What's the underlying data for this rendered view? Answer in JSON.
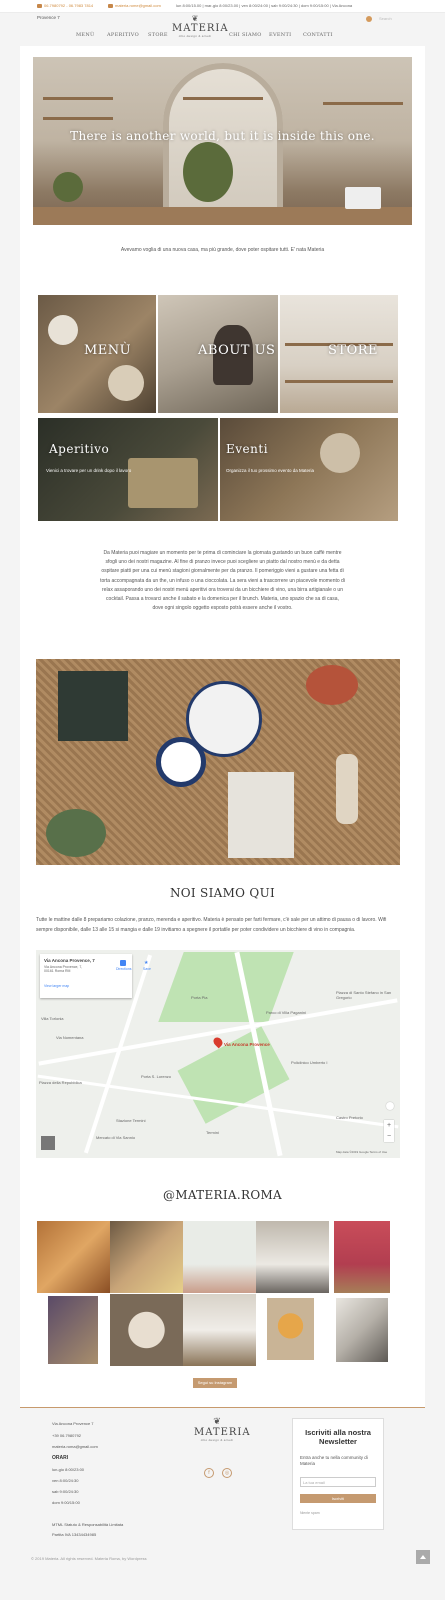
{
  "topbar": {
    "phone": "06.7980792 - 06.7983 7814",
    "email": "materia.rome@gmail.com",
    "hours": "lun 8:00/15.00 | mar-gio 8:00/23.00 | ven 8:00/24:00 | sab 9:00/24:30 | dom 9:00/15:00 | Via Ancona"
  },
  "header": {
    "location": "Provence 7",
    "search_placeholder": "Search",
    "logo_word": "MATERIA",
    "logo_sub": "cibo design & arredi",
    "nav": [
      "MENÙ",
      "APERITIVO",
      "STORE",
      "",
      "CHI SIAMO",
      "EVENTI",
      "CONTATTI"
    ]
  },
  "hero": {
    "title": "There is another world, but it is inside this one."
  },
  "intro": "Avevamo voglia di una nuova casa, ma più grande, dove poter ospitare tutti. E' nata Materia",
  "tiles": [
    {
      "label": "MENÙ"
    },
    {
      "label": "ABOUT US"
    },
    {
      "label": "STORE"
    },
    {
      "label": "Aperitivo",
      "desc": "Vienici a trovare per un drink dopo il lavoro"
    },
    {
      "label": "Eventi",
      "desc": "Organizza il tuo prossimo evento da Materia"
    }
  ],
  "about_paragraph": "Da Materia puoi magiare un momento per te prima di cominciare la giornata gustando un buon caffè mentre sfogli uno dei nostri magazine. Al fine di pranzo invece puoi scegliere un piatto dal nostro menù e da detta ospitare piatti per una cui menù stagioni giornalmente per da pranzo. Il pomeriggio vieni a gustare una fetta di torta accompagnata da un the, un infuso o una cioccolata. La sera vieni a trascorrere un piacevole momento di relax assaporando uno dei nostri menù aperitivi ora troverai da un bicchiere di vino, una birra artigianale o un cocktail. Passa a trovarci anche il sabato e la domenica per il brunch. Materia, uno spazio che sa di casa, dove ogni singolo oggetto esposto potrà essere anche il vostro.",
  "where": {
    "title": "NOI SIAMO QUI",
    "text": "Tutte le mattine dalle 8 prepariamo colazione, pranzo, merenda e aperitivo. Materia è pensato per farti fermare, c'è sale per un attimo di pausa o di lavoro. Wifi sempre disponibile, dalle 13 alle 15 si mangia e dalle 19 invitiamo a spegnere il portatile per poter condividere un bicchiere di vino in compagnia."
  },
  "map": {
    "place": "Via Ancona Provence, 7",
    "address": "Via Ancona Provence, 7, 00161 Roma RM",
    "directions": "Directions",
    "save": "Save",
    "larger": "View larger map",
    "pin_label": "Via Ancona Provence",
    "labels": [
      "Villa Torlonia",
      "Piazza di Santo Stefano in San Gregorio",
      "Policlinico Umberto I",
      "Porta S. Lorenzo",
      "Piazza della Repubblica",
      "Stazione Termini",
      "Porta Pia",
      "Termini",
      "Parco di Villa Paganini",
      "Via Nomentana",
      "Castro Pretorio",
      "Mercato di Via Sannio"
    ],
    "footer": "Map data ©2019 Google  Terms of Use"
  },
  "instagram": {
    "title": "@MATERIA.ROMA",
    "button": "Segui su Instagram"
  },
  "footer": {
    "address": "Via Ancona Provence 7",
    "phone": "+39 06.7980792",
    "email": "materia.roma@gmail.com",
    "hours_title": "ORARI",
    "hours": [
      "lun-gio 8:00/23:00",
      "ven 8:00/24:30",
      "sab 9:00/24:30",
      "dom 9:00/15:00"
    ],
    "policy": "MTML Statuto & Responsabilità Limitata",
    "vat": "Partita IVA 13434434985",
    "logo_word": "MATERIA",
    "logo_sub": "cibo design & arredi"
  },
  "newsletter": {
    "title": "Iscriviti alla nostra Newsletter",
    "desc": "Entra anche tu nella community di Materia",
    "placeholder": "La tua email",
    "button": "Iscriviti",
    "spam": "Niente spam"
  },
  "copyright": "© 2019 Materia. All rights reserved. Materia Roma, by Wordpress",
  "colors": {
    "accent": "#c59a70",
    "orange_link": "#d08a3c",
    "instagram_icon": "#d49a5c"
  },
  "icons": [
    "phone-icon",
    "mail-icon",
    "cart-icon",
    "facebook-icon",
    "instagram-icon",
    "back-to-top-icon"
  ]
}
